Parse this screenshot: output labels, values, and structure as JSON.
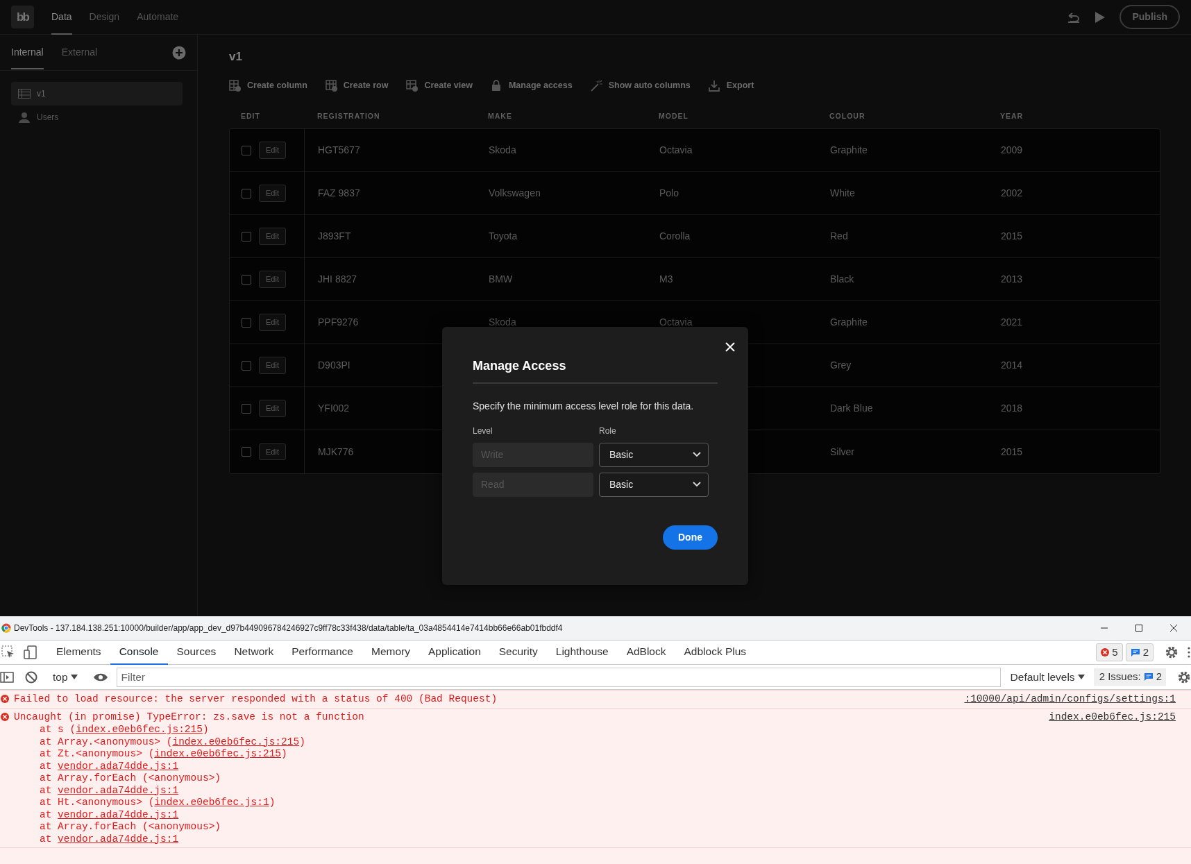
{
  "app": {
    "logo": "bb",
    "tabs": [
      {
        "label": "Data",
        "selected": true
      },
      {
        "label": "Design",
        "selected": false
      },
      {
        "label": "Automate",
        "selected": false
      }
    ],
    "publish": "Publish"
  },
  "sidebar": {
    "tabs": [
      {
        "label": "Internal",
        "selected": true
      },
      {
        "label": "External",
        "selected": false
      }
    ],
    "items": [
      {
        "label": "v1",
        "kind": "table",
        "selected": true
      },
      {
        "label": "Users",
        "kind": "users",
        "selected": false
      }
    ]
  },
  "page": {
    "title": "v1",
    "toolbar": [
      {
        "label": "Create column",
        "kind": "column"
      },
      {
        "label": "Create row",
        "kind": "row"
      },
      {
        "label": "Create view",
        "kind": "view"
      },
      {
        "label": "Manage access",
        "kind": "lock"
      },
      {
        "label": "Show auto columns",
        "kind": "wand"
      },
      {
        "label": "Export",
        "kind": "export"
      }
    ]
  },
  "table": {
    "edit_column": "EDIT",
    "columns": [
      "REGISTRATION",
      "MAKE",
      "MODEL",
      "COLOUR",
      "YEAR"
    ],
    "rows": [
      {
        "checked": false,
        "edit": "Edit",
        "cells": [
          "HGT5677",
          "Skoda",
          "Octavia",
          "Graphite",
          "2009"
        ]
      },
      {
        "checked": false,
        "edit": "Edit",
        "cells": [
          "FAZ 9837",
          "Volkswagen",
          "Polo",
          "White",
          "2002"
        ]
      },
      {
        "checked": false,
        "edit": "Edit",
        "cells": [
          "J893FT",
          "Toyota",
          "Corolla",
          "Red",
          "2015"
        ]
      },
      {
        "checked": false,
        "edit": "Edit",
        "cells": [
          "JHI 8827",
          "BMW",
          "M3",
          "Black",
          "2013"
        ]
      },
      {
        "checked": false,
        "edit": "Edit",
        "cells": [
          "PPF9276",
          "Skoda",
          "Octavia",
          "Graphite",
          "2021"
        ]
      },
      {
        "checked": false,
        "edit": "Edit",
        "cells": [
          "D903PI",
          null,
          null,
          "Grey",
          "2014"
        ]
      },
      {
        "checked": false,
        "edit": "Edit",
        "cells": [
          "YFI002",
          null,
          null,
          "Dark Blue",
          "2018"
        ]
      },
      {
        "checked": false,
        "edit": "Edit",
        "cells": [
          "MJK776",
          null,
          null,
          "Silver",
          "2015"
        ]
      }
    ]
  },
  "modal": {
    "title": "Manage Access",
    "text": "Specify the minimum access level role for this data.",
    "level_label": "Level",
    "role_label": "Role",
    "rows": [
      {
        "placeholder": "Write",
        "role": "Basic"
      },
      {
        "placeholder": "Read",
        "role": "Basic"
      }
    ],
    "done": "Done"
  },
  "devtools": {
    "title": "DevTools - 137.184.138.251:10000/builder/app/app_dev_d97b449096784246927c9ff78c33f438/data/table/ta_03a4854414e7414bb66e66ab01fbddf4",
    "tabs": [
      {
        "label": "Elements",
        "selected": false
      },
      {
        "label": "Console",
        "selected": true
      },
      {
        "label": "Sources",
        "selected": false
      },
      {
        "label": "Network",
        "selected": false
      },
      {
        "label": "Performance",
        "selected": false
      },
      {
        "label": "Memory",
        "selected": false
      },
      {
        "label": "Application",
        "selected": false
      },
      {
        "label": "Security",
        "selected": false
      },
      {
        "label": "Lighthouse",
        "selected": false
      },
      {
        "label": "AdBlock",
        "selected": false
      },
      {
        "label": "Adblock Plus",
        "selected": false
      }
    ],
    "error_count": "5",
    "message_count": "2",
    "context": "top",
    "filter_placeholder": "Filter",
    "levels": "Default levels",
    "issues_label": "2 Issues:",
    "issues_count": "2",
    "messages": [
      {
        "kind": "error",
        "text": "Failed to load resource: the server responded with a status of 400 (Bad Request)",
        "source": ":10000/api/admin/configs/settings:1"
      },
      {
        "kind": "error",
        "text": "Uncaught (in promise) TypeError: zs.save is not a function",
        "source": "index.e0eb6fec.js:215",
        "stack": [
          {
            "before": "at s (",
            "link": "index.e0eb6fec.js:215",
            "after": ")"
          },
          {
            "before": "at Array.<anonymous> (",
            "link": "index.e0eb6fec.js:215",
            "after": ")"
          },
          {
            "before": "at Zt.<anonymous> (",
            "link": "index.e0eb6fec.js:215",
            "after": ")"
          },
          {
            "before": "at ",
            "link": "vendor.ada74dde.js:1"
          },
          {
            "before": "at Array.forEach (<anonymous>)"
          },
          {
            "before": "at ",
            "link": "vendor.ada74dde.js:1"
          },
          {
            "before": "at Ht.<anonymous> (",
            "link": "index.e0eb6fec.js:1",
            "after": ")"
          },
          {
            "before": "at ",
            "link": "vendor.ada74dde.js:1"
          },
          {
            "before": "at Array.forEach (<anonymous>)"
          },
          {
            "before": "at ",
            "link": "vendor.ada74dde.js:1"
          }
        ]
      }
    ]
  }
}
